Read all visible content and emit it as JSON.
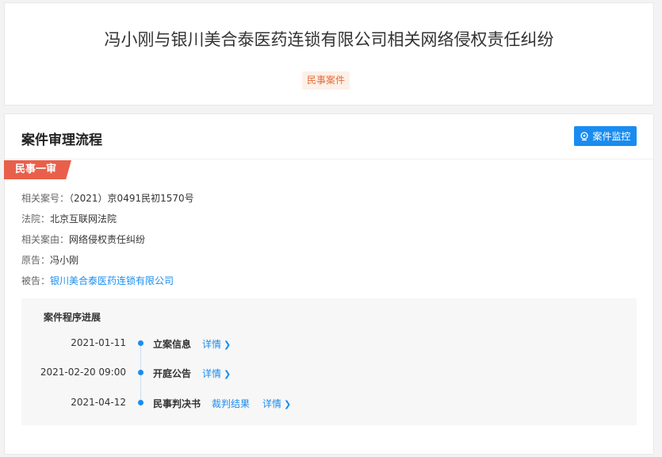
{
  "header": {
    "title": "冯小刚与银川美合泰医药连锁有限公司相关网络侵权责任纠纷",
    "tag": "民事案件"
  },
  "section": {
    "title": "案件审理流程",
    "monitor_button": "案件监控",
    "stage": "民事一审"
  },
  "info": {
    "case_no_label": "相关案号：",
    "case_no": "（2021）京0491民初1570号",
    "court_label": "法院：",
    "court": "北京互联网法院",
    "cause_label": "相关案由：",
    "cause": "网络侵权责任纠纷",
    "plaintiff_label": "原告：",
    "plaintiff": "冯小刚",
    "defendant_label": "被告：",
    "defendant": "银川美合泰医药连锁有限公司"
  },
  "progress": {
    "title": "案件程序进展",
    "events": [
      {
        "date": "2021-01-11",
        "name": "立案信息",
        "extra": "",
        "detail": "详情"
      },
      {
        "date": "2021-02-20 09:00",
        "name": "开庭公告",
        "extra": "",
        "detail": "详情"
      },
      {
        "date": "2021-04-12",
        "name": "民事判决书",
        "extra": "裁判结果",
        "detail": "详情"
      }
    ]
  },
  "icons": {
    "monitor": "location-pin-icon",
    "chevron": "chevron-right-icon"
  },
  "colors": {
    "accent": "#1a8cf0",
    "stage_badge": "#e8604b",
    "tag_text": "#e36d3b",
    "tag_bg": "#fdf0e8"
  }
}
